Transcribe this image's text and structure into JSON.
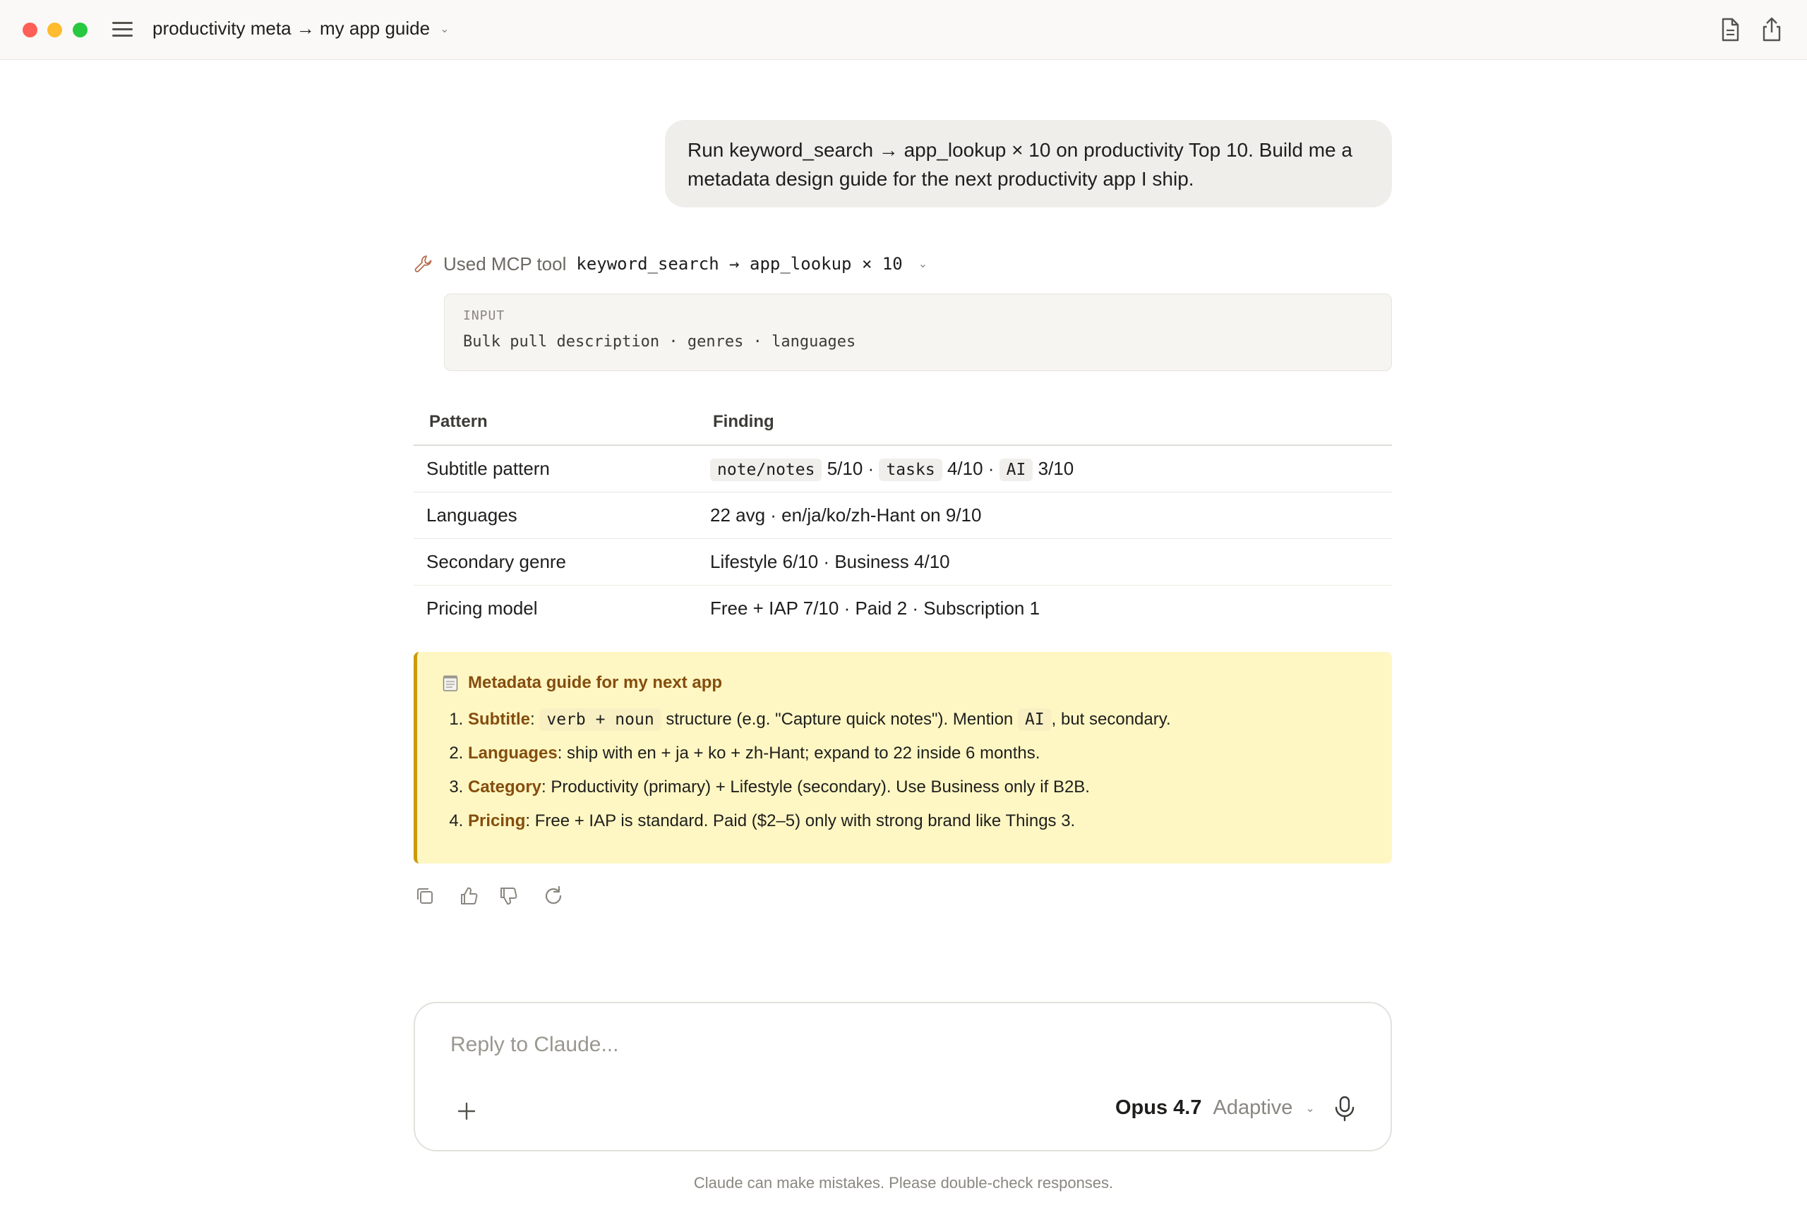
{
  "window": {
    "title": "productivity meta → my app guide"
  },
  "user_message": "Run keyword_search → app_lookup × 10 on productivity Top 10. Build me a metadata design guide for the next productivity app I ship.",
  "tool_use": {
    "used_label": "Used MCP tool",
    "tool_name": "keyword_search → app_lookup × 10",
    "input_label": "INPUT",
    "input_value": "Bulk pull description · genres · languages"
  },
  "findings_table": {
    "headers": [
      "Pattern",
      "Finding"
    ],
    "rows": [
      {
        "pattern": "Subtitle pattern",
        "chips": [
          {
            "code": "note/notes",
            "text": "5/10 ·"
          },
          {
            "code": "tasks",
            "text": "4/10 ·"
          },
          {
            "code": "AI",
            "text": "3/10"
          }
        ]
      },
      {
        "pattern": "Languages",
        "finding": "22 avg · en/ja/ko/zh-Hant on 9/10"
      },
      {
        "pattern": "Secondary genre",
        "finding": "Lifestyle 6/10 · Business 4/10"
      },
      {
        "pattern": "Pricing model",
        "finding": "Free + IAP 7/10 · Paid 2 · Subscription 1"
      }
    ]
  },
  "guide": {
    "title": "Metadata guide for my next app",
    "icon": "memo-icon",
    "items": [
      {
        "key": "Subtitle",
        "pre": ": ",
        "code1": "verb + noun",
        "mid": " structure (e.g. \"Capture quick notes\"). Mention ",
        "code2": "AI",
        "post": ", but secondary."
      },
      {
        "key": "Languages",
        "text": ": ship with en + ja + ko + zh-Hant; expand to 22 inside 6 months."
      },
      {
        "key": "Category",
        "text": ": Productivity (primary) + Lifestyle (secondary). Use Business only if B2B."
      },
      {
        "key": "Pricing",
        "text": ": Free + IAP is standard. Paid ($2–5) only with strong brand like Things 3."
      }
    ]
  },
  "composer": {
    "placeholder": "Reply to Claude...",
    "model": "Opus 4.7",
    "mode": "Adaptive"
  },
  "disclaimer": "Claude can make mistakes. Please double-check responses.",
  "colors": {
    "guide_bg": "#fef7c3",
    "guide_accent": "#854d0e",
    "guide_border": "#cc9a06"
  }
}
